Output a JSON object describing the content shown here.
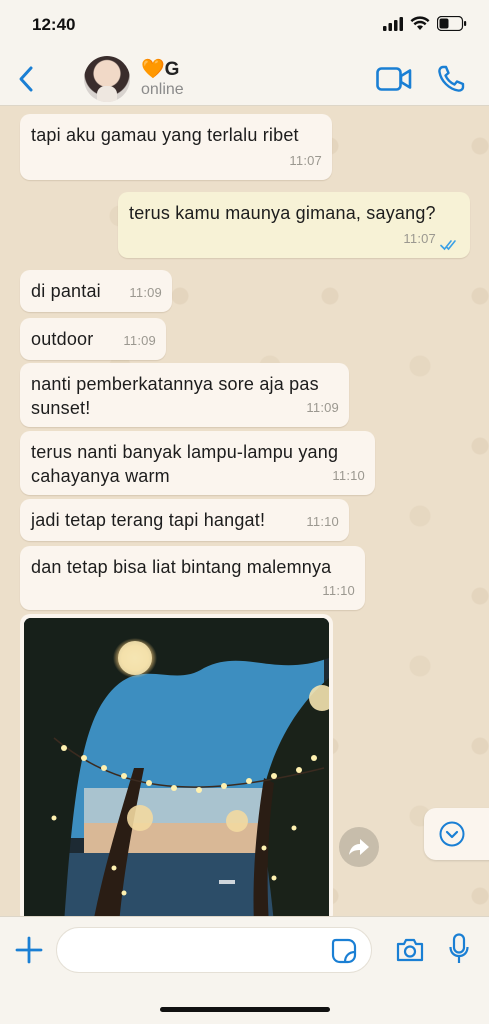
{
  "status_bar": {
    "time": "12:40"
  },
  "header": {
    "contact_name": "🧡G",
    "contact_status": "online"
  },
  "messages": [
    {
      "direction": "in",
      "text": "tapi aku gamau yang terlalu ribet",
      "time": "11:07"
    },
    {
      "direction": "out",
      "text": "terus kamu maunya gimana, sayang?",
      "time": "11:07",
      "read": true
    },
    {
      "direction": "in",
      "text": "di pantai",
      "time": "11:09"
    },
    {
      "direction": "in",
      "text": "outdoor",
      "time": "11:09"
    },
    {
      "direction": "in",
      "text": "nanti pemberkatannya sore aja pas\nsunset!",
      "time": "11:09"
    },
    {
      "direction": "in",
      "text": "terus nanti banyak lampu-lampu yang\ncahayanya warm",
      "time": "11:10"
    },
    {
      "direction": "in",
      "text": "jadi tetap terang tapi hangat!",
      "time": "11:10"
    },
    {
      "direction": "in",
      "text": "dan tetap bisa liat bintang malemnya",
      "time": "11:10"
    }
  ],
  "photo_message": {
    "direction": "in",
    "subject": "lanterns-in-trees-by-sea"
  },
  "input": {
    "placeholder": ""
  },
  "colors": {
    "accent": "#1a7fd4",
    "chat_bg": "#ecdfca",
    "incoming_bubble": "#fbf5ee",
    "outgoing_bubble": "#f7f2d6",
    "read_ticks": "#3aa0e6"
  },
  "icons": {
    "back": "chevron-left-icon",
    "video": "video-camera-icon",
    "call": "phone-icon",
    "forward": "forward-arrow-icon",
    "scroll_down": "chevron-down-circle-icon",
    "plus": "plus-icon",
    "sticker": "sticker-icon",
    "camera": "camera-icon",
    "mic": "microphone-icon"
  }
}
